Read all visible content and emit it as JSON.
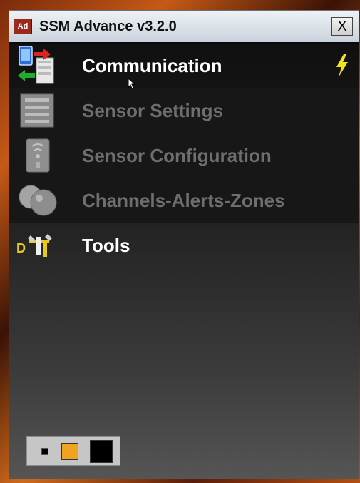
{
  "window": {
    "app_icon_text": "Ad",
    "title": "SSM Advance v3.2.0",
    "close_label": "X"
  },
  "menu": {
    "items": [
      {
        "label": "Communication",
        "icon": "communication-icon",
        "enabled": true
      },
      {
        "label": "Sensor Settings",
        "icon": "sensor-settings-icon",
        "enabled": false
      },
      {
        "label": "Sensor Configuration",
        "icon": "sensor-configuration-icon",
        "enabled": false
      },
      {
        "label": "Channels-Alerts-Zones",
        "icon": "channels-alerts-zones-icon",
        "enabled": false
      },
      {
        "label": "Tools",
        "icon": "tools-icon",
        "enabled": true
      }
    ]
  },
  "status": {
    "connection_icon": "lightning-bolt-icon",
    "bolt_color": "#f4e21c"
  },
  "theme_swatches": [
    {
      "name": "small-square",
      "color": "#000000"
    },
    {
      "name": "orange",
      "color": "#f0a320"
    },
    {
      "name": "black",
      "color": "#000000"
    }
  ]
}
